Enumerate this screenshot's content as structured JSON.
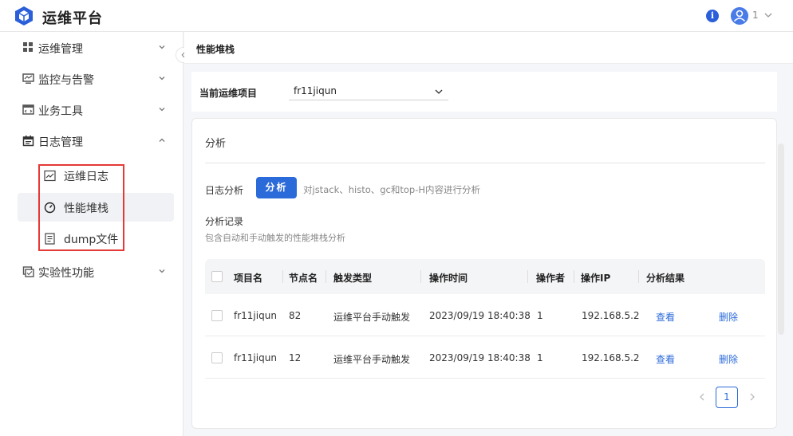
{
  "app": {
    "title": "运维平台"
  },
  "header": {
    "user_name": "1",
    "info_icon": "i"
  },
  "sidebar": {
    "items": [
      {
        "label": "运维管理",
        "icon": "grid-icon"
      },
      {
        "label": "监控与告警",
        "icon": "monitor-icon"
      },
      {
        "label": "业务工具",
        "icon": "code-window-icon"
      },
      {
        "label": "日志管理",
        "icon": "calendar-icon",
        "expanded": true
      },
      {
        "label": "实验性功能",
        "icon": "lab-icon"
      }
    ],
    "sub_items": [
      {
        "label": "运维日志",
        "icon": "chart-icon"
      },
      {
        "label": "性能堆栈",
        "icon": "gauge-icon",
        "active": true
      },
      {
        "label": "dump文件",
        "icon": "document-icon"
      }
    ]
  },
  "page": {
    "title": "性能堆栈"
  },
  "project": {
    "label": "当前运维项目",
    "value": "fr11jiqun"
  },
  "analysis": {
    "section_title": "分析",
    "log_label": "日志分析",
    "button_label": "分析",
    "description": "对jstack、histo、gc和top-H内容进行分析",
    "records_title": "分析记录",
    "records_subtitle": "包含自动和手动触发的性能堆栈分析"
  },
  "table": {
    "headers": [
      "项目名",
      "节点名",
      "触发类型",
      "操作时间",
      "操作者",
      "操作IP",
      "分析结果"
    ],
    "rows": [
      {
        "project": "fr11jiqun",
        "node": "82",
        "trigger": "运维平台手动触发",
        "time": "2023/09/19 18:40:38",
        "operator": "1",
        "ip": "192.168.5.2",
        "view": "查看",
        "delete": "删除"
      },
      {
        "project": "fr11jiqun",
        "node": "12",
        "trigger": "运维平台手动触发",
        "time": "2023/09/19 18:40:38",
        "operator": "1",
        "ip": "192.168.5.2",
        "view": "查看",
        "delete": "删除"
      }
    ]
  },
  "pagination": {
    "current": "1"
  },
  "colors": {
    "accent": "#2b6ad9",
    "highlight": "#e53935"
  }
}
